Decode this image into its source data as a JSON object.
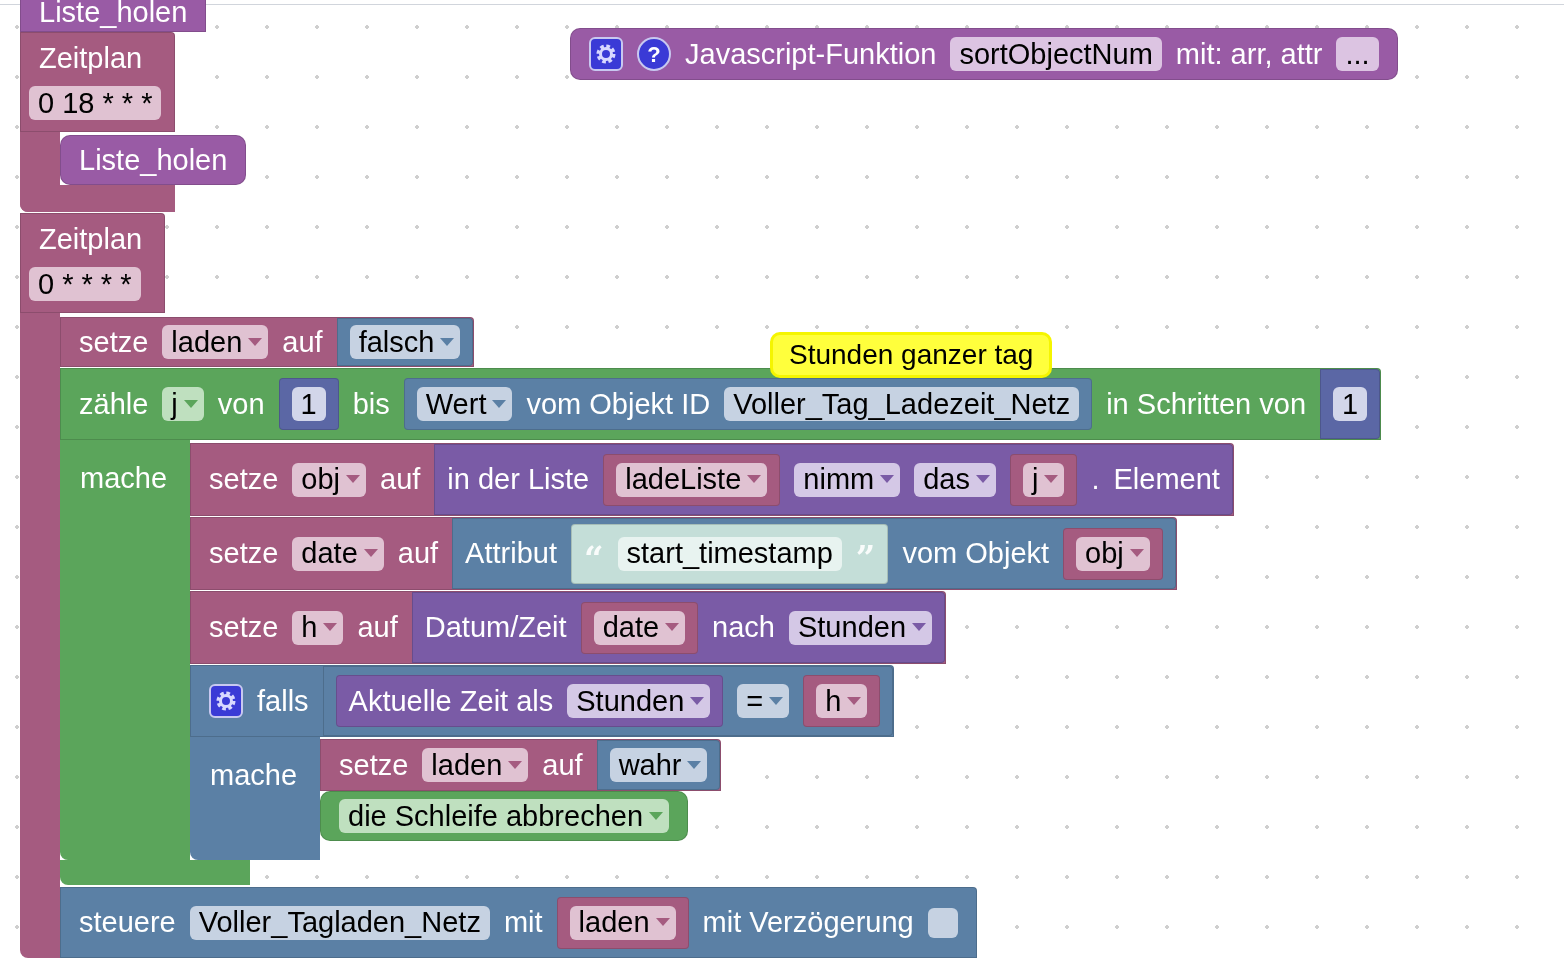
{
  "blocks": [
    {
      "kind": "procedure",
      "rows": [
        [
          {
            "kind": "label",
            "text": "Liste_holen"
          }
        ]
      ]
    },
    {
      "kind": "variable",
      "rows": [
        [
          {
            "kind": "label",
            "text": "Zeitplan"
          }
        ],
        [
          {
            "kind": "field",
            "text": "0 18 * * *"
          }
        ]
      ]
    },
    {
      "kind": "procedure",
      "rows": [
        [
          {
            "kind": "gear"
          },
          {
            "kind": "help",
            "text": "?"
          },
          {
            "kind": "label",
            "text": "Javascript-Funktion"
          },
          {
            "kind": "field",
            "text": "sortObjectNum"
          },
          {
            "kind": "label",
            "text": "mit: arr, attr"
          },
          {
            "kind": "field",
            "text": "..."
          }
        ]
      ]
    },
    {
      "kind": "procedure",
      "rows": [
        [
          {
            "kind": "label",
            "text": "Liste_holen"
          }
        ]
      ]
    },
    {
      "kind": "variable",
      "rows": [
        [
          {
            "kind": "label",
            "text": "Zeitplan"
          }
        ],
        [
          {
            "kind": "field",
            "text": "0 * * * *"
          }
        ]
      ]
    },
    {
      "kind": "variable",
      "rows": [
        [
          {
            "kind": "label",
            "text": "setze"
          },
          {
            "kind": "dropdown",
            "text": "laden"
          },
          {
            "kind": "label",
            "text": "auf"
          },
          {
            "kind": "logic",
            "parts": [
              {
                "kind": "dropdown",
                "text": "falsch"
              }
            ]
          }
        ]
      ]
    },
    {
      "kind": "loop",
      "comment": "Stunden ganzer tag",
      "rows": [
        [
          {
            "kind": "label",
            "text": "zähle"
          },
          {
            "kind": "dropdown",
            "text": "j"
          },
          {
            "kind": "label",
            "text": "von"
          },
          {
            "kind": "math",
            "parts": [
              {
                "kind": "field",
                "text": "1"
              }
            ]
          },
          {
            "kind": "label",
            "text": "bis"
          },
          {
            "kind": "logic",
            "parts": [
              {
                "kind": "dropdown",
                "text": "Wert"
              },
              {
                "kind": "label",
                "text": "vom Objekt ID"
              },
              {
                "kind": "field",
                "text": "Voller_Tag_Ladezeit_Netz"
              }
            ]
          },
          {
            "kind": "label",
            "text": "in Schritten von"
          },
          {
            "kind": "math",
            "parts": [
              {
                "kind": "field",
                "text": "1"
              }
            ]
          }
        ],
        [
          {
            "kind": "label",
            "text": "mache"
          }
        ]
      ]
    },
    {
      "kind": "variable",
      "rows": [
        [
          {
            "kind": "label",
            "text": "setze"
          },
          {
            "kind": "dropdown",
            "text": "obj"
          },
          {
            "kind": "label",
            "text": "auf"
          },
          {
            "kind": "list",
            "parts": [
              {
                "kind": "label",
                "text": "in der Liste"
              },
              {
                "kind": "variable",
                "parts": [
                  {
                    "kind": "dropdown",
                    "text": "ladeListe"
                  }
                ]
              },
              {
                "kind": "dropdown",
                "text": "nimm"
              },
              {
                "kind": "dropdown",
                "text": "das"
              },
              {
                "kind": "variable",
                "parts": [
                  {
                    "kind": "dropdown",
                    "text": "j"
                  }
                ]
              },
              {
                "kind": "label",
                "text": "."
              },
              {
                "kind": "label",
                "text": "Element"
              }
            ]
          }
        ]
      ]
    },
    {
      "kind": "variable",
      "rows": [
        [
          {
            "kind": "label",
            "text": "setze"
          },
          {
            "kind": "dropdown",
            "text": "date"
          },
          {
            "kind": "label",
            "text": "auf"
          },
          {
            "kind": "logic",
            "parts": [
              {
                "kind": "label",
                "text": "Attribut"
              },
              {
                "kind": "text",
                "parts": [
                  {
                    "kind": "quote",
                    "text": "“"
                  },
                  {
                    "kind": "field",
                    "text": "start_timestamp"
                  },
                  {
                    "kind": "quote",
                    "text": "”"
                  }
                ]
              },
              {
                "kind": "label",
                "text": "vom Objekt"
              },
              {
                "kind": "variable",
                "parts": [
                  {
                    "kind": "dropdown",
                    "text": "obj"
                  }
                ]
              }
            ]
          }
        ]
      ]
    },
    {
      "kind": "variable",
      "rows": [
        [
          {
            "kind": "label",
            "text": "setze"
          },
          {
            "kind": "dropdown",
            "text": "h"
          },
          {
            "kind": "label",
            "text": "auf"
          },
          {
            "kind": "list",
            "parts": [
              {
                "kind": "label",
                "text": "Datum/Zeit"
              },
              {
                "kind": "variable",
                "parts": [
                  {
                    "kind": "dropdown",
                    "text": "date"
                  }
                ]
              },
              {
                "kind": "label",
                "text": "nach"
              },
              {
                "kind": "dropdown",
                "text": "Stunden"
              }
            ]
          }
        ]
      ]
    },
    {
      "kind": "logic",
      "rows": [
        [
          {
            "kind": "gear"
          },
          {
            "kind": "label",
            "text": "falls"
          },
          {
            "kind": "logic",
            "parts": [
              {
                "kind": "list",
                "parts": [
                  {
                    "kind": "label",
                    "text": "Aktuelle Zeit als"
                  },
                  {
                    "kind": "dropdown",
                    "text": "Stunden"
                  }
                ]
              },
              {
                "kind": "dropdown",
                "text": "="
              },
              {
                "kind": "variable",
                "parts": [
                  {
                    "kind": "dropdown",
                    "text": "h"
                  }
                ]
              }
            ]
          }
        ],
        [
          {
            "kind": "label",
            "text": "mache"
          }
        ]
      ]
    },
    {
      "kind": "variable",
      "rows": [
        [
          {
            "kind": "label",
            "text": "setze"
          },
          {
            "kind": "dropdown",
            "text": "laden"
          },
          {
            "kind": "label",
            "text": "auf"
          },
          {
            "kind": "logic",
            "parts": [
              {
                "kind": "dropdown",
                "text": "wahr"
              }
            ]
          }
        ]
      ]
    },
    {
      "kind": "loop",
      "rows": [
        [
          {
            "kind": "dropdown",
            "text": "die Schleife abbrechen"
          }
        ]
      ]
    },
    {
      "kind": "logic",
      "rows": [
        [
          {
            "kind": "label",
            "text": "steuere"
          },
          {
            "kind": "field",
            "text": "Voller_Tagladen_Netz"
          },
          {
            "kind": "label",
            "text": "mit"
          },
          {
            "kind": "variable",
            "parts": [
              {
                "kind": "dropdown",
                "text": "laden"
              }
            ]
          },
          {
            "kind": "label",
            "text": "mit Verzögerung"
          },
          {
            "kind": "checkbox",
            "checked": false
          }
        ]
      ]
    }
  ]
}
